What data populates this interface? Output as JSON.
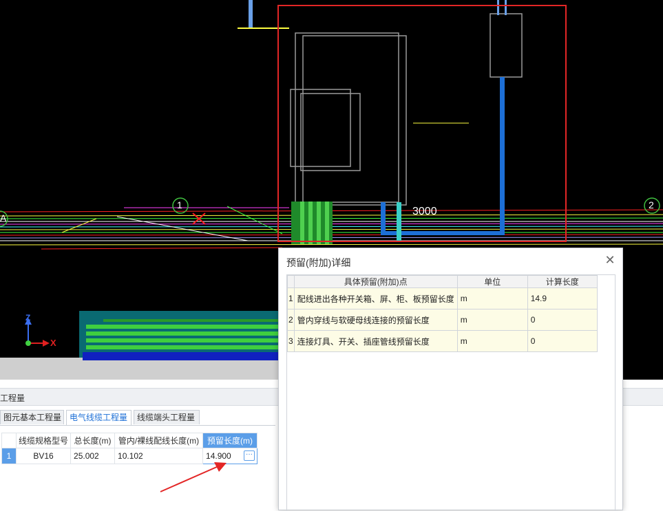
{
  "viewport": {
    "dimension_label": "3000",
    "axis_labels": [
      "1",
      "2",
      "A"
    ],
    "axis_z": "Z",
    "axis_x": "X"
  },
  "qty_panel": {
    "title": "工程量",
    "tabs": [
      {
        "label": "图元基本工程量",
        "active": false
      },
      {
        "label": "电气线缆工程量",
        "active": true
      },
      {
        "label": "线缆端头工程量",
        "active": false
      }
    ],
    "columns": [
      "线缆规格型号",
      "总长度(m)",
      "管内/裸线配线长度(m)",
      "预留长度(m)"
    ],
    "rows": [
      {
        "index": "1",
        "spec": "BV16",
        "total": "25.002",
        "in_pipe": "10.102",
        "reserved": "14.900",
        "more": "···"
      }
    ]
  },
  "dialog": {
    "title": "预留(附加)详细",
    "close": "✕",
    "columns": [
      "具体预留(附加)点",
      "单位",
      "计算长度"
    ],
    "rows": [
      {
        "index": "1",
        "point": "配线进出各种开关箱、屏、柜、板预留长度",
        "unit": "m",
        "length": "14.9"
      },
      {
        "index": "2",
        "point": "管内穿线与软硬母线连接的预留长度",
        "unit": "m",
        "length": "0"
      },
      {
        "index": "3",
        "point": "连接灯具、开关、插座管线预留长度",
        "unit": "m",
        "length": "0"
      }
    ]
  },
  "colors": {
    "highlight_blue": "#5b9ee8",
    "selection_red": "#e32626",
    "row_bg": "#fdfce6"
  }
}
